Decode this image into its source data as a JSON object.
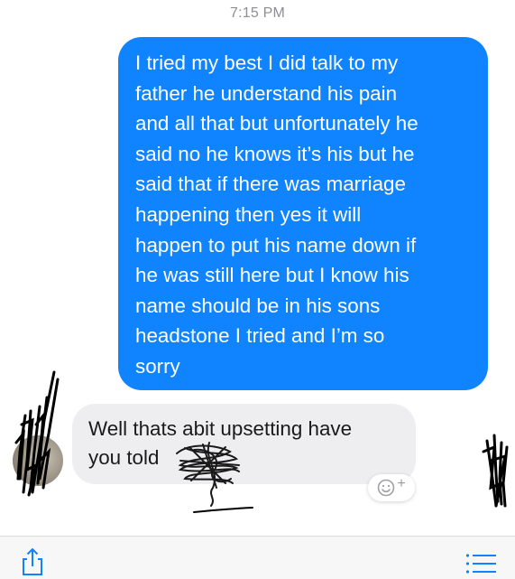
{
  "header": {
    "timestamp": "7:15 PM"
  },
  "messages": [
    {
      "direction": "outgoing",
      "lines": [
        "I tried my best I did talk to my",
        "father he understand his pain",
        "and all that but unfortunately he",
        "said no he knows it’s his but he",
        "said that if there was marriage",
        "happening then yes it will",
        "happen to put his name down if",
        "he was still here but I know his",
        "name should be in his sons",
        "headstone I tried and I’m so",
        "sorry"
      ]
    },
    {
      "direction": "incoming",
      "lines": [
        "Well thats abit upsetting have",
        "you told"
      ]
    }
  ],
  "reaction_button": {
    "icon": "smiley-add-icon",
    "plus": "+"
  },
  "toolbar": {
    "left_icon": "share-icon",
    "right_icon": "list-icon"
  },
  "colors": {
    "outgoing_bubble": "#1083fe",
    "incoming_bubble": "#eeeef0",
    "accent": "#1083fe"
  }
}
